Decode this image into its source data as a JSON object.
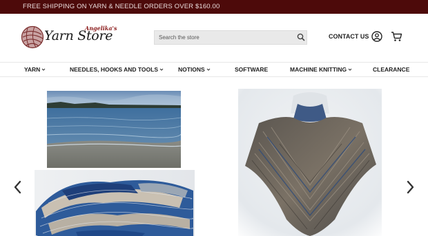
{
  "promo": {
    "text": "FREE SHIPPING ON YARN & NEEDLE ORDERS OVER $160.00"
  },
  "logo": {
    "small": "Angelika's",
    "main": "Yarn Store"
  },
  "search": {
    "placeholder": "Search the store"
  },
  "header": {
    "contact_label": "CONTACT US"
  },
  "nav": {
    "items": [
      {
        "label": "YARN"
      },
      {
        "label": "NEEDLES, HOOKS AND TOOLS"
      },
      {
        "label": "NOTIONS"
      },
      {
        "label": "SOFTWARE"
      },
      {
        "label": "MACHINE KNITTING"
      },
      {
        "label": "CLEARANCE"
      }
    ]
  },
  "colors": {
    "promo_bar": "#4d0a0a",
    "accent": "#8a1a1a"
  },
  "icons": [
    "yarn-ball-logo-icon",
    "search-icon",
    "account-icon",
    "cart-icon",
    "chevron-down-icon",
    "chevron-left-icon",
    "chevron-right-icon"
  ]
}
